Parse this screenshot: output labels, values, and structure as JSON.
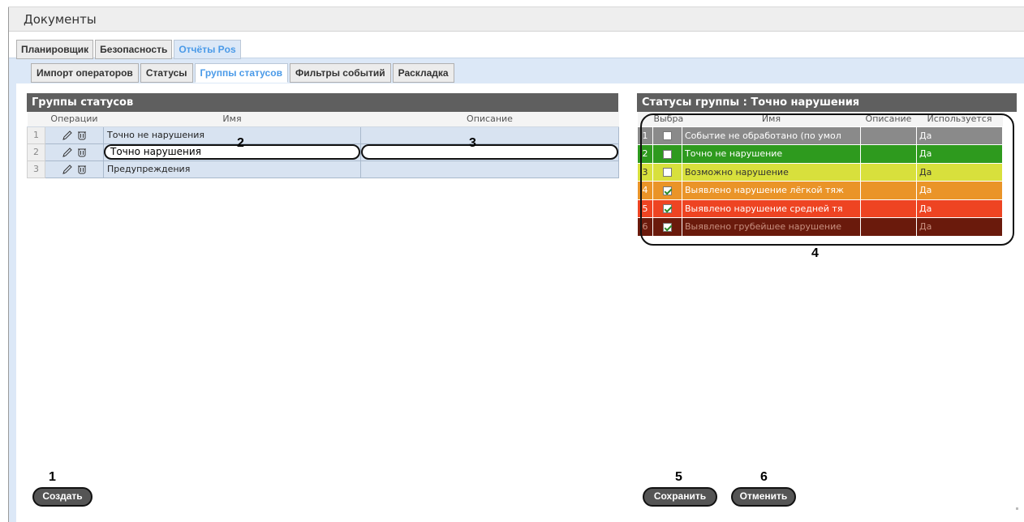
{
  "window": {
    "title": "Документы"
  },
  "main_tabs": [
    {
      "label": "Планировщик",
      "active": false
    },
    {
      "label": "Безопасность",
      "active": false
    },
    {
      "label": "Отчёты Pos",
      "active": true
    }
  ],
  "sub_tabs": [
    {
      "label": "Импорт операторов",
      "active": false
    },
    {
      "label": "Статусы",
      "active": false
    },
    {
      "label": "Группы статусов",
      "active": true
    },
    {
      "label": "Фильтры событий",
      "active": false
    },
    {
      "label": "Раскладка",
      "active": false
    }
  ],
  "groups_panel": {
    "title": "Группы статусов",
    "columns": {
      "ops": "Операции",
      "name": "Имя",
      "description": "Описание"
    },
    "rows": [
      {
        "num": "1",
        "name": "Точно не нарушения",
        "description": ""
      },
      {
        "num": "2",
        "name": "Точно нарушения",
        "description": ""
      },
      {
        "num": "3",
        "name": "Предупреждения",
        "description": ""
      }
    ]
  },
  "statuses_panel": {
    "title": "Статусы группы : Точно нарушения",
    "columns": {
      "select": "Выбра",
      "name": "Имя",
      "description": "Описание",
      "used": "Используется"
    },
    "rows": [
      {
        "num": "1",
        "checked": false,
        "name": "Событие не обработано (по умол",
        "description": "",
        "used": "Да",
        "color": "#8a8a8a",
        "text_color": "#ffffff"
      },
      {
        "num": "2",
        "checked": false,
        "name": "Точно не нарушение",
        "description": "",
        "used": "Да",
        "color": "#2e9a1e",
        "text_color": "#ffffff"
      },
      {
        "num": "3",
        "checked": false,
        "name": "Возможно нарушение",
        "description": "",
        "used": "Да",
        "color": "#d8e03c",
        "text_color": "#333333"
      },
      {
        "num": "4",
        "checked": true,
        "name": "Выявлено нарушение лёгкой тяж",
        "description": "",
        "used": "Да",
        "color": "#ea9428",
        "text_color": "#ffffff"
      },
      {
        "num": "5",
        "checked": true,
        "name": "Выявлено нарушение средней тя",
        "description": "",
        "used": "Да",
        "color": "#ee4422",
        "text_color": "#ffffff"
      },
      {
        "num": "6",
        "checked": true,
        "name": "Выявлено грубейшее нарушение",
        "description": "",
        "used": "Да",
        "color": "#6a1a0c",
        "text_color": "#c89080"
      }
    ]
  },
  "buttons": {
    "create": "Создать",
    "save": "Сохранить",
    "cancel": "Отменить"
  },
  "markers": {
    "m1": "1",
    "m2": "2",
    "m3": "3",
    "m4": "4",
    "m5": "5",
    "m6": "6"
  },
  "icons": {
    "edit": "pencil-icon",
    "delete": "trash-icon"
  }
}
